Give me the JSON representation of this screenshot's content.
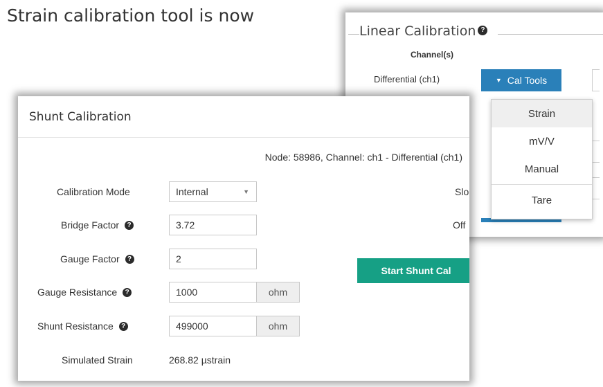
{
  "headline": "Strain calibration tool is now",
  "linear_calibration": {
    "title": "Linear Calibration",
    "channels_label": "Channel(s)",
    "channel_name": "Differential (ch1)",
    "cal_tools_label": "Cal Tools",
    "dropdown": {
      "items": [
        "Strain",
        "mV/V",
        "Manual",
        "Tare"
      ],
      "active": "Strain"
    }
  },
  "shunt_calibration": {
    "title": "Shunt Calibration",
    "node_info": "Node: 58986, Channel: ch1 - Differential (ch1)",
    "fields": {
      "calibration_mode": {
        "label": "Calibration Mode",
        "value": "Internal"
      },
      "bridge_factor": {
        "label": "Bridge Factor",
        "value": "3.72"
      },
      "gauge_factor": {
        "label": "Gauge Factor",
        "value": "2"
      },
      "gauge_resistance": {
        "label": "Gauge Resistance",
        "value": "1000",
        "unit": "ohm"
      },
      "shunt_resistance": {
        "label": "Shunt Resistance",
        "value": "499000",
        "unit": "ohm"
      }
    },
    "simulated_strain": {
      "label": "Simulated Strain",
      "value": "268.82 µstrain"
    },
    "slope_label_clipped": "Slo",
    "offset_label_clipped": "Off",
    "start_button": "Start Shunt Cal"
  },
  "colors": {
    "cal_tools_button": "#2a80b9",
    "start_button": "#16a085",
    "dropdown_active": "#efefef",
    "addon_background": "#eeeeee"
  },
  "icons": [
    "help-icon",
    "chevron-down-icon",
    "caret-down-icon"
  ]
}
